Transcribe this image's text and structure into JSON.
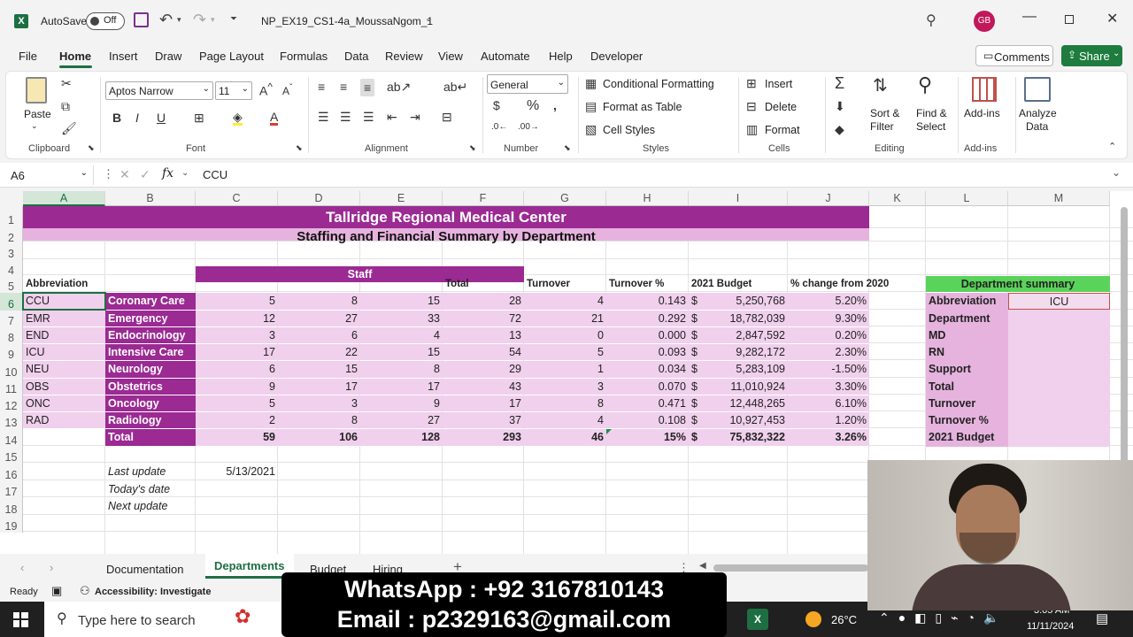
{
  "titlebar": {
    "app_icon": "excel-icon",
    "autosave_label": "AutoSave",
    "autosave_state": "Off",
    "filename": "NP_EX19_CS1-4a_MoussaNgom_1",
    "avatar": "GB"
  },
  "menu": [
    "File",
    "Home",
    "Insert",
    "Draw",
    "Page Layout",
    "Formulas",
    "Data",
    "Review",
    "View",
    "Automate",
    "Help",
    "Developer"
  ],
  "comments_label": "Comments",
  "share_label": "Share",
  "ribbon": {
    "paste": "Paste",
    "clipboard": "Clipboard",
    "font_name": "Aptos Narrow",
    "font_size": "11",
    "font": "Font",
    "alignment": "Alignment",
    "number_format": "General",
    "number": "Number",
    "conditional": "Conditional Formatting",
    "format_table": "Format as Table",
    "cell_styles": "Cell Styles",
    "styles": "Styles",
    "insert": "Insert",
    "delete": "Delete",
    "format": "Format",
    "cells": "Cells",
    "sort1": "Sort &",
    "sort2": "Filter",
    "find1": "Find &",
    "find2": "Select",
    "editing": "Editing",
    "addins": "Add-ins",
    "addins_group": "Add-ins",
    "analyze1": "Analyze",
    "analyze2": "Data"
  },
  "formula": {
    "namebox": "A6",
    "fx": "fx",
    "content": "CCU"
  },
  "columns": [
    "A",
    "B",
    "C",
    "D",
    "E",
    "F",
    "G",
    "H",
    "I",
    "J",
    "K",
    "L",
    "M"
  ],
  "rows": [
    "1",
    "2",
    "3",
    "4",
    "5",
    "6",
    "7",
    "8",
    "9",
    "10",
    "11",
    "12",
    "13",
    "14",
    "15",
    "16",
    "17",
    "18",
    "19"
  ],
  "sheet": {
    "title": "Tallridge Regional Medical Center",
    "subtitle": "Staffing and Financial Summary by Department",
    "staff_label": "Staff",
    "headers": {
      "abbr": "Abbreviation",
      "total": "Total",
      "turnover": "Turnover",
      "turnover_pct": "Turnover %",
      "budget": "2021 Budget",
      "change": "% change from 2020"
    },
    "depts": [
      {
        "abbr": "CCU",
        "name": "Coronary Care",
        "md": "5",
        "rn": "8",
        "sup": "15",
        "total": "28",
        "turnover": "4",
        "pct": "0.143",
        "cur": "$",
        "budget": "5,250,768",
        "change": "5.20%"
      },
      {
        "abbr": "EMR",
        "name": "Emergency",
        "md": "12",
        "rn": "27",
        "sup": "33",
        "total": "72",
        "turnover": "21",
        "pct": "0.292",
        "cur": "$",
        "budget": "18,782,039",
        "change": "9.30%"
      },
      {
        "abbr": "END",
        "name": "Endocrinology",
        "md": "3",
        "rn": "6",
        "sup": "4",
        "total": "13",
        "turnover": "0",
        "pct": "0.000",
        "cur": "$",
        "budget": "2,847,592",
        "change": "0.20%"
      },
      {
        "abbr": "ICU",
        "name": "Intensive Care",
        "md": "17",
        "rn": "22",
        "sup": "15",
        "total": "54",
        "turnover": "5",
        "pct": "0.093",
        "cur": "$",
        "budget": "9,282,172",
        "change": "2.30%"
      },
      {
        "abbr": "NEU",
        "name": "Neurology",
        "md": "6",
        "rn": "15",
        "sup": "8",
        "total": "29",
        "turnover": "1",
        "pct": "0.034",
        "cur": "$",
        "budget": "5,283,109",
        "change": "-1.50%"
      },
      {
        "abbr": "OBS",
        "name": "Obstetrics",
        "md": "9",
        "rn": "17",
        "sup": "17",
        "total": "43",
        "turnover": "3",
        "pct": "0.070",
        "cur": "$",
        "budget": "11,010,924",
        "change": "3.30%"
      },
      {
        "abbr": "ONC",
        "name": "Oncology",
        "md": "5",
        "rn": "3",
        "sup": "9",
        "total": "17",
        "turnover": "8",
        "pct": "0.471",
        "cur": "$",
        "budget": "12,448,265",
        "change": "6.10%"
      },
      {
        "abbr": "RAD",
        "name": "Radiology",
        "md": "2",
        "rn": "8",
        "sup": "27",
        "total": "37",
        "turnover": "4",
        "pct": "0.108",
        "cur": "$",
        "budget": "10,927,453",
        "change": "1.20%"
      }
    ],
    "totals": {
      "label": "Total",
      "md": "59",
      "rn": "106",
      "sup": "128",
      "total": "293",
      "turnover": "46",
      "pct": "15%",
      "cur": "$",
      "budget": "75,832,322",
      "change": "3.26%"
    },
    "last_update_label": "Last update",
    "last_update": "5/13/2021",
    "todays_date_label": "Today's date",
    "next_update_label": "Next update",
    "summary": {
      "title": "Department summary",
      "abbr_label": "Abbreviation",
      "abbr_value": "ICU",
      "labels": [
        "Department",
        "MD",
        "RN",
        "Support",
        "Total",
        "Turnover",
        "Turnover %",
        "2021 Budget"
      ]
    }
  },
  "tabs": [
    "Documentation",
    "Departments",
    "Budget",
    "Hiring"
  ],
  "status": {
    "ready": "Ready",
    "accessibility": "Accessibility: Investigate"
  },
  "banner": {
    "line1": "WhatsApp : +92  3167810143",
    "line2": "Email : p2329163@gmail.com"
  },
  "taskbar": {
    "search": "Type here to search",
    "temp": "26°C",
    "time": "3:05 AM",
    "date": "11/11/2024"
  }
}
